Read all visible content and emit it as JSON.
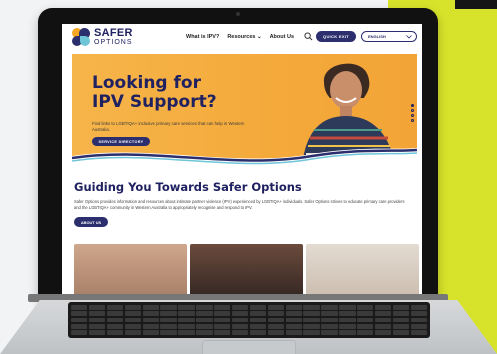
{
  "header": {
    "logo_line1": "SAFER",
    "logo_line2": "OPTIONS",
    "nav": [
      {
        "label": "What is IPV?"
      },
      {
        "label": "Resources ⌄"
      },
      {
        "label": "About Us"
      }
    ],
    "quick_exit_label": "QUICK EXIT",
    "language_label": "ENGLISH"
  },
  "hero": {
    "title_line1": "Looking for",
    "title_line2": "IPV Support?",
    "subtitle": "Find links to LGBTIQA+ inclusive primary care services that can help in Western Australia.",
    "button_label": "SERVICE DIRECTORY",
    "slide_count": 4,
    "active_slide": 1
  },
  "main": {
    "heading": "Guiding You Towards Safer Options",
    "paragraph": "Safer Options provides information and resources about intimate partner violence (IPV) experienced by LGBTIQA+ individuals. Safer Options strives to educate primary care providers and the LGBTIQA+ community in Western Australia to appropriately recognise and respond to IPV.",
    "about_button_label": "ABOUT US"
  },
  "colors": {
    "brand_navy": "#2c2f6e",
    "hero_orange": "#f4a93a",
    "background_lime": "#d7e32a"
  }
}
